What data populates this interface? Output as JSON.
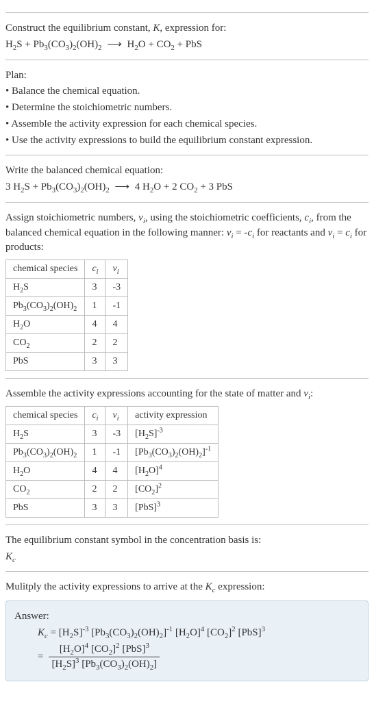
{
  "header": {
    "line1": "Construct the equilibrium constant, K, expression for:",
    "equation": "H₂S + Pb₃(CO₃)₂(OH)₂  ⟶  H₂O + CO₂ + PbS"
  },
  "plan": {
    "title": "Plan:",
    "items": [
      "Balance the chemical equation.",
      "Determine the stoichiometric numbers.",
      "Assemble the activity expression for each chemical species.",
      "Use the activity expressions to build the equilibrium constant expression."
    ]
  },
  "balanced": {
    "title": "Write the balanced chemical equation:",
    "equation": "3 H₂S + Pb₃(CO₃)₂(OH)₂  ⟶  4 H₂O + 2 CO₂ + 3 PbS"
  },
  "assign": {
    "text_before": "Assign stoichiometric numbers, νᵢ, using the stoichiometric coefficients, cᵢ, from the balanced chemical equation in the following manner: νᵢ = -cᵢ for reactants and νᵢ = cᵢ for products:",
    "cols": {
      "species": "chemical species",
      "ci": "cᵢ",
      "vi": "νᵢ"
    },
    "rows": [
      {
        "species": "H₂S",
        "ci": "3",
        "vi": "-3"
      },
      {
        "species": "Pb₃(CO₃)₂(OH)₂",
        "ci": "1",
        "vi": "-1"
      },
      {
        "species": "H₂O",
        "ci": "4",
        "vi": "4"
      },
      {
        "species": "CO₂",
        "ci": "2",
        "vi": "2"
      },
      {
        "species": "PbS",
        "ci": "3",
        "vi": "3"
      }
    ]
  },
  "activity": {
    "title": "Assemble the activity expressions accounting for the state of matter and νᵢ:",
    "cols": {
      "species": "chemical species",
      "ci": "cᵢ",
      "vi": "νᵢ",
      "act": "activity expression"
    },
    "rows": [
      {
        "species": "H₂S",
        "ci": "3",
        "vi": "-3",
        "act": "[H₂S]⁻³"
      },
      {
        "species": "Pb₃(CO₃)₂(OH)₂",
        "ci": "1",
        "vi": "-1",
        "act": "[Pb₃(CO₃)₂(OH)₂]⁻¹"
      },
      {
        "species": "H₂O",
        "ci": "4",
        "vi": "4",
        "act": "[H₂O]⁴"
      },
      {
        "species": "CO₂",
        "ci": "2",
        "vi": "2",
        "act": "[CO₂]²"
      },
      {
        "species": "PbS",
        "ci": "3",
        "vi": "3",
        "act": "[PbS]³"
      }
    ]
  },
  "symbol": {
    "title": "The equilibrium constant symbol in the concentration basis is:",
    "value": "K_c"
  },
  "multiply": {
    "title": "Mulitply the activity expressions to arrive at the K_c expression:"
  },
  "answer": {
    "label": "Answer:",
    "line1": "K_c = [H₂S]⁻³ [Pb₃(CO₃)₂(OH)₂]⁻¹ [H₂O]⁴ [CO₂]² [PbS]³",
    "frac_num": "[H₂O]⁴ [CO₂]² [PbS]³",
    "frac_den": "[H₂S]³ [Pb₃(CO₃)₂(OH)₂]"
  },
  "chart_data": null
}
